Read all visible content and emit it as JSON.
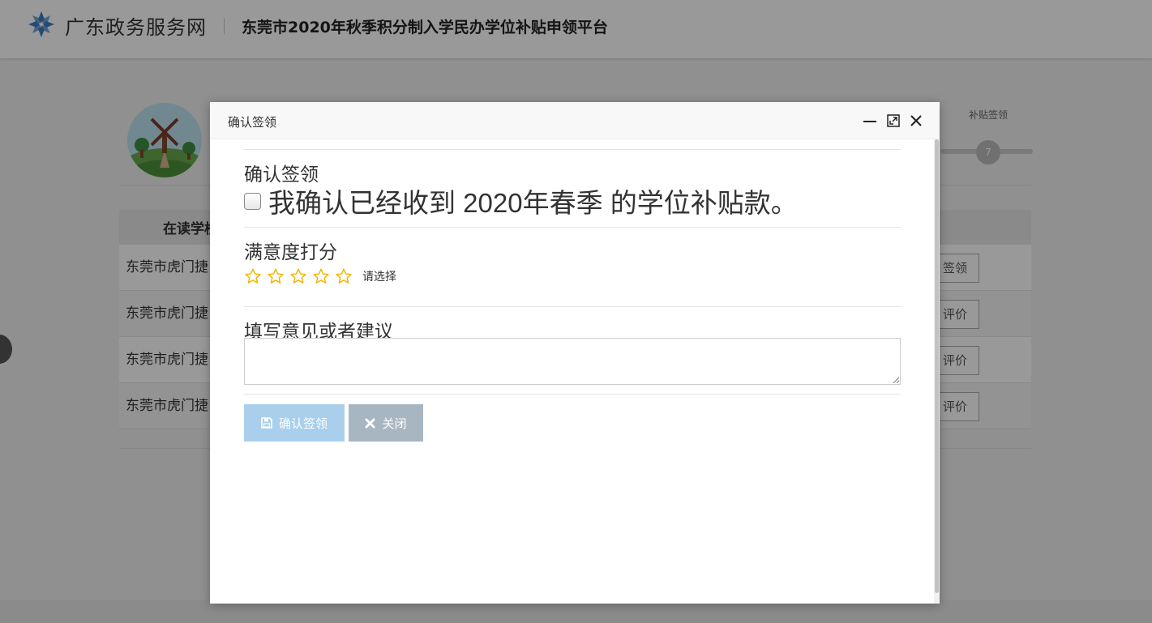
{
  "header": {
    "brand": "广东政务服务网",
    "platform_title": "东莞市2020年秋季积分制入学民办学位补贴申领平台"
  },
  "steps": {
    "label": "补贴签领",
    "dot": "7"
  },
  "table": {
    "head_label": "在读学校",
    "rows": [
      {
        "school": "东莞市虎门捷",
        "action": "签领"
      },
      {
        "school": "东莞市虎门捷",
        "action": "评价"
      },
      {
        "school": "东莞市虎门捷",
        "action": "评价"
      },
      {
        "school": "东莞市虎门捷",
        "action": "评价"
      }
    ]
  },
  "modal": {
    "title": "确认签领",
    "confirm_section_label": "确认签领",
    "confirm_text": "我确认已经收到 2020年春季 的学位补贴款。",
    "rating_label": "满意度打分",
    "rating_hint": "请选择",
    "rating_value": 0,
    "rating_max": 5,
    "feedback_label": "填写意见或者建议",
    "feedback_value": "",
    "confirm_button": "确认签领",
    "close_button": "关闭"
  },
  "colors": {
    "star": "#f4b400",
    "confirm_button_bg": "#a9cfec",
    "close_button_bg": "#a8b6c2",
    "logo": "#3b7fc4"
  }
}
